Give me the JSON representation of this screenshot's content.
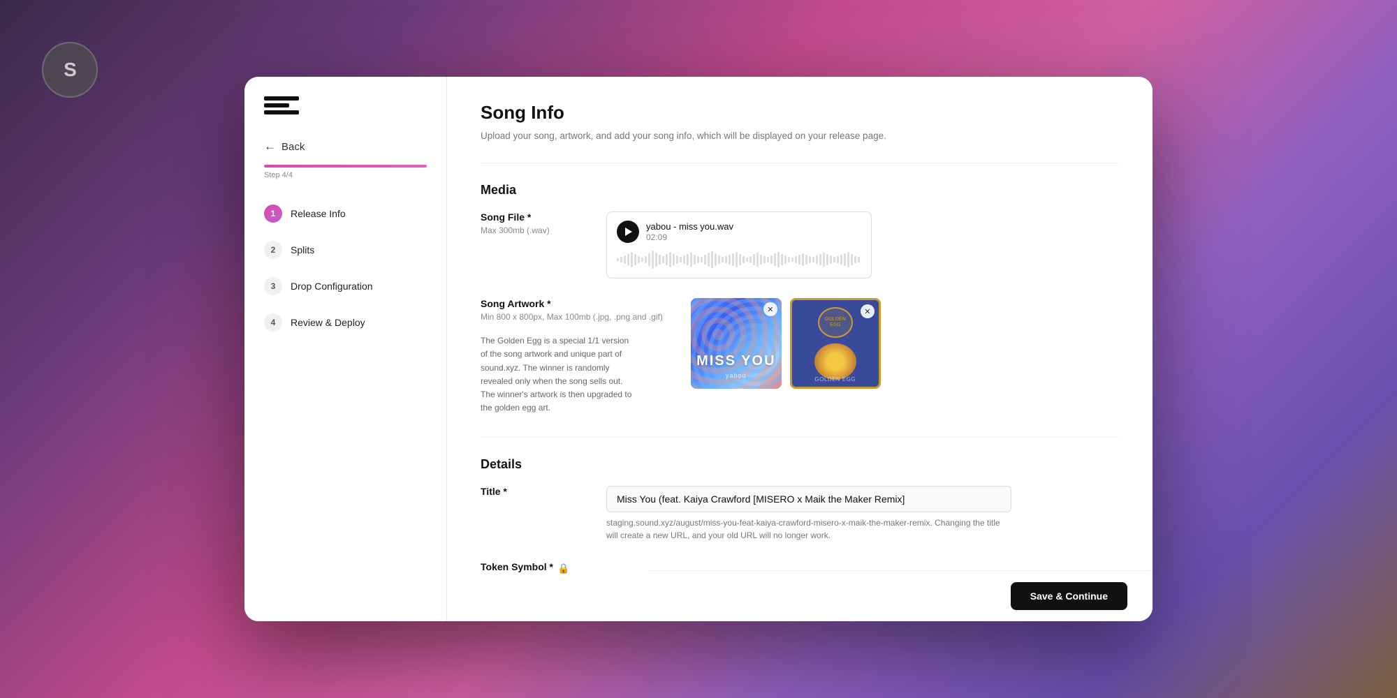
{
  "app": {
    "icon_label": "S",
    "logo_alt": "Sound logo"
  },
  "sidebar": {
    "back_label": "Back",
    "step_label": "Step 4/4",
    "progress_percent": 100,
    "nav_items": [
      {
        "step": "1",
        "label": "Release Info",
        "state": "active"
      },
      {
        "step": "2",
        "label": "Splits",
        "state": "inactive"
      },
      {
        "step": "3",
        "label": "Drop Configuration",
        "state": "inactive"
      },
      {
        "step": "4",
        "label": "Review & Deploy",
        "state": "inactive"
      }
    ]
  },
  "main": {
    "title": "Song Info",
    "subtitle": "Upload your song, artwork, and add your song info, which will be displayed on your release page.",
    "media_section": "Media",
    "song_file": {
      "label": "Song File *",
      "sublabel": "Max 300mb (.wav)",
      "filename": "yabou - miss you.wav",
      "duration": "02:09"
    },
    "song_artwork": {
      "label": "Song Artwork *",
      "sublabel": "Min 800 x 800px, Max 100mb (.jpg, .png and .gif)",
      "golden_egg_desc": "The Golden Egg is a special 1/1 version of the song artwork and unique part of sound.xyz. The winner is randomly revealed only when the song sells out. The winner's artwork is then upgraded to the golden egg art.",
      "artwork1_text": "MISS YOU",
      "artwork1_sub": "yabou",
      "artwork2_badge": "GOLDEN EGG"
    },
    "details_section": "Details",
    "title_field": {
      "label": "Title *",
      "value": "Miss You (feat. Kaiya Crawford [MISERO x Maik the Maker Remix]",
      "url_hint": "staging.sound.xyz/august/miss-you-feat-kaiya-crawford-misero-x-maik-the-maker-remix. Changing the title will create a new URL, and your old URL will no longer work."
    },
    "token_symbol_field": {
      "label": "Token Symbol *",
      "lock_icon": "🔒"
    },
    "save_button": "Save & Continue"
  }
}
